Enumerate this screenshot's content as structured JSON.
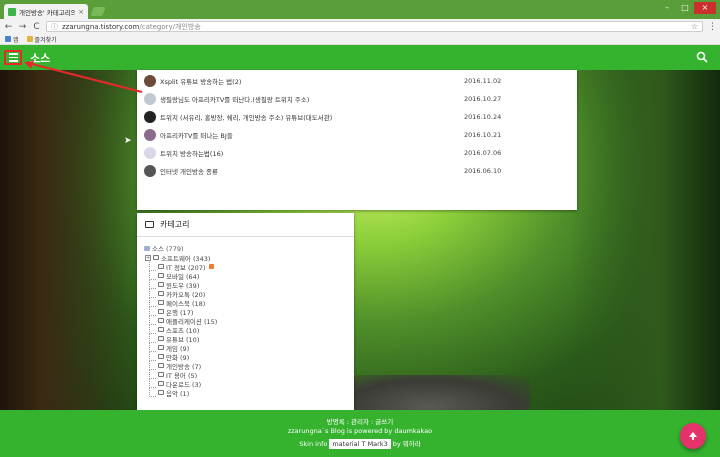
{
  "browser": {
    "tab_title": "개인방송' 카테고리의 글",
    "tab_close": "×",
    "url_host": "zzarungna.tistory.com",
    "url_path": "/category/개인방송",
    "back": "←",
    "forward": "→",
    "reload": "C",
    "star": "☆",
    "menu": "⋮",
    "bookmarks": [
      "앱",
      "즐겨찾기"
    ],
    "window_controls": [
      "–",
      "□",
      "×"
    ]
  },
  "app": {
    "title": "소스",
    "accent": "#35b32f"
  },
  "posts": [
    {
      "title": "Xsplit 유튜브 방송하는 법(2)",
      "date": "2016.11.02"
    },
    {
      "title": "생필랑님도 아프리카TV를 떠난다.(생필랑 트위치 주소)",
      "date": "2016.10.27"
    },
    {
      "title": "트위치 (서유리, 홍방장, 쉐리, 개인방송 주소) 유튜브(대도서관)",
      "date": "2016.10.24"
    },
    {
      "title": "아프리카TV를 떠나는 BJ들",
      "date": "2016.10.21"
    },
    {
      "title": "트위치 방송하는법(16)",
      "date": "2016.07.06"
    },
    {
      "title": "인터넷 개인방송 종류",
      "date": "2016.06.10"
    }
  ],
  "categories": {
    "header": "카테고리",
    "root": "소스 (779)",
    "items": [
      {
        "label": "소프트웨어 (343)",
        "toggle": "+"
      },
      {
        "label": "IT 정보 (207)",
        "new": true
      },
      {
        "label": "모바일 (64)"
      },
      {
        "label": "윈도우 (39)"
      },
      {
        "label": "카카오톡 (20)"
      },
      {
        "label": "페이스북 (18)"
      },
      {
        "label": "은행 (17)"
      },
      {
        "label": "애플리케이션 (15)"
      },
      {
        "label": "스포츠 (10)"
      },
      {
        "label": "유튜브 (10)"
      },
      {
        "label": "게임 (9)"
      },
      {
        "label": "만화 (9)"
      },
      {
        "label": "개인방송 (7)"
      },
      {
        "label": "IT 용어 (5)"
      },
      {
        "label": "다운로드 (3)"
      },
      {
        "label": "음악 (1)"
      }
    ]
  },
  "footer": {
    "line1": "방명록 : 관리자 : 글쓰기",
    "line2": "zzarungna`s Blog is powered by daumkakao",
    "skin_prefix": "Skin info",
    "skin_name": "material T Mark3",
    "skin_suffix": "by 뭐하라"
  },
  "fab_icon": "arrow-up-icon"
}
